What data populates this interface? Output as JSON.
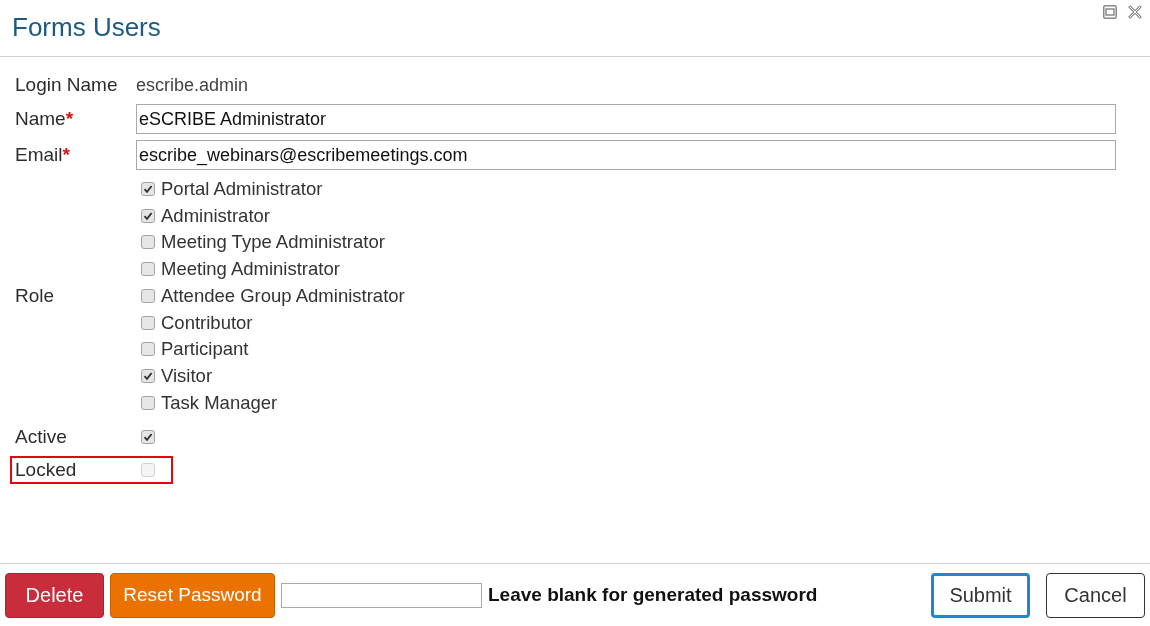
{
  "window": {
    "title": "Forms Users"
  },
  "fields": [
    {
      "kind": "text",
      "label": "Login Name",
      "value": "escribe.admin"
    },
    {
      "kind": "input",
      "label": "Name",
      "required_mark": "*",
      "value": "eSCRIBE Administrator"
    },
    {
      "kind": "input",
      "label": "Email",
      "required_mark": "*",
      "value": "escribe_webinars@escribemeetings.com"
    },
    {
      "kind": "checklist",
      "label": "Role",
      "options": [
        {
          "label": "Portal Administrator",
          "checked": true
        },
        {
          "label": "Administrator",
          "checked": true
        },
        {
          "label": "Meeting Type Administrator",
          "checked": false
        },
        {
          "label": "Meeting Administrator",
          "checked": false
        },
        {
          "label": "Attendee Group Administrator",
          "checked": false
        },
        {
          "label": "Contributor",
          "checked": false
        },
        {
          "label": "Participant",
          "checked": false
        },
        {
          "label": "Visitor",
          "checked": true
        },
        {
          "label": "Task Manager",
          "checked": false
        }
      ]
    },
    {
      "kind": "checkbox",
      "label": "Active",
      "checked": true,
      "disabled": false,
      "highlighted": false
    },
    {
      "kind": "checkbox",
      "label": "Locked",
      "checked": false,
      "disabled": true,
      "highlighted": true
    }
  ],
  "footer": {
    "actions": [
      {
        "kind": "danger",
        "label": "Delete"
      },
      {
        "kind": "warning",
        "label": "Reset Password"
      }
    ],
    "password_hint": "Leave blank for generated password",
    "buttons": [
      {
        "label": "Submit",
        "focused": true
      },
      {
        "label": "Cancel",
        "focused": false
      }
    ]
  }
}
